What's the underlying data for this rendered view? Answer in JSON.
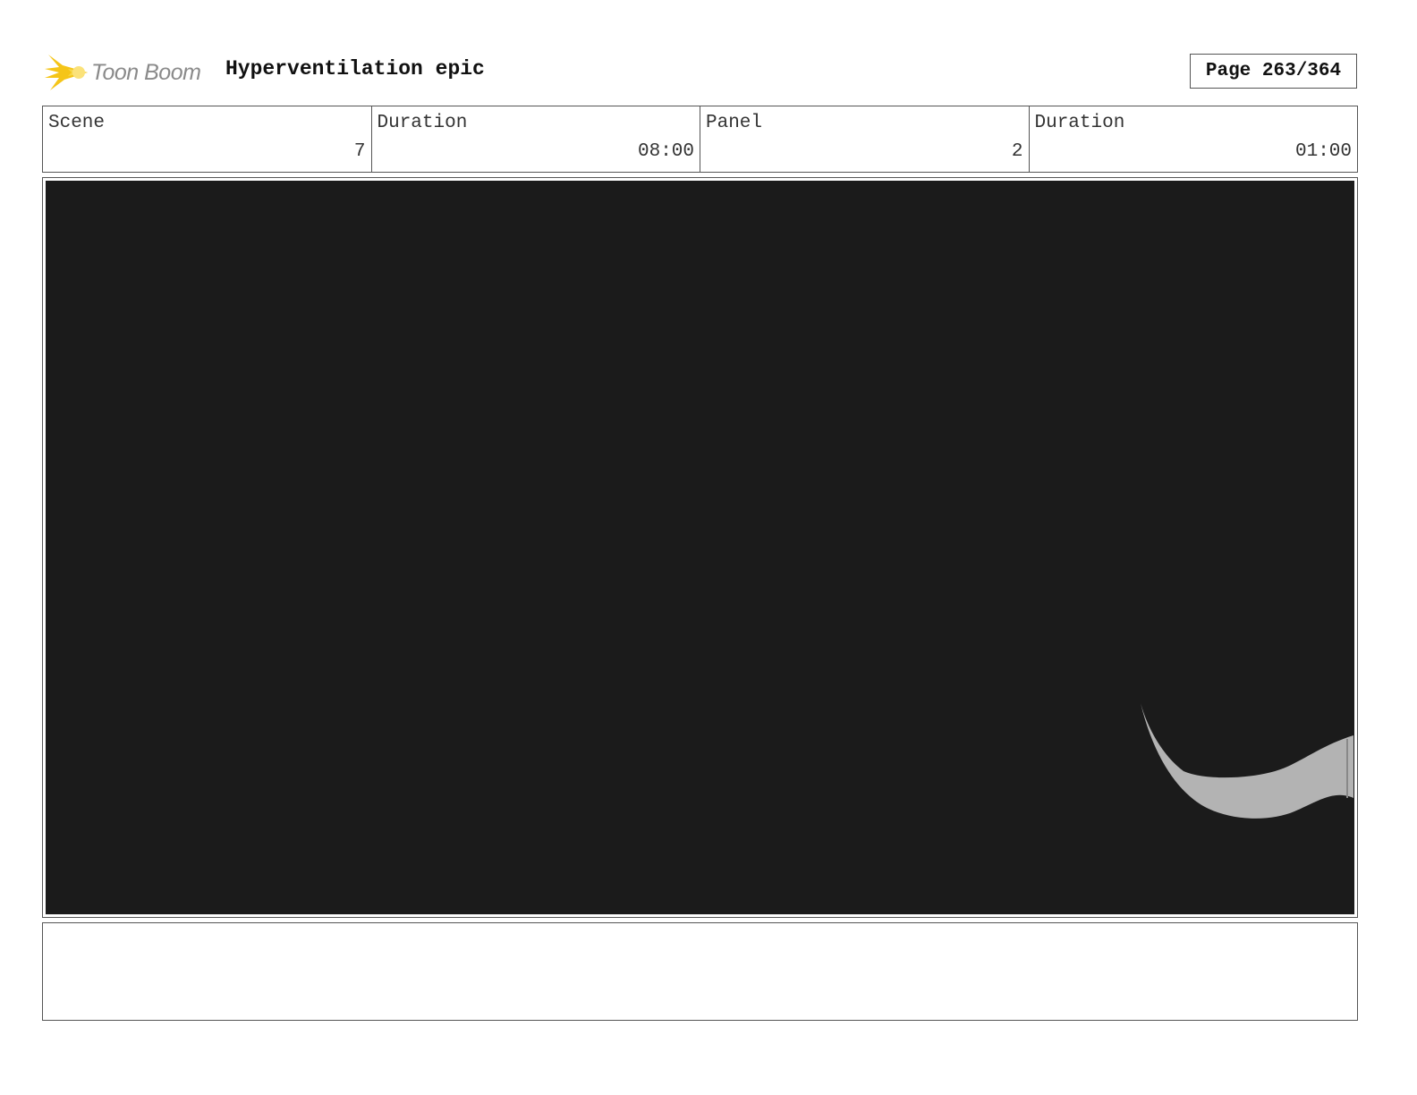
{
  "header": {
    "logo_text": "Toon Boom",
    "project_title": "Hyperventilation epic",
    "page_label": "Page 263/364"
  },
  "info": {
    "scene_label": "Scene",
    "scene_value": "7",
    "scene_duration_label": "Duration",
    "scene_duration_value": "08:00",
    "panel_label": "Panel",
    "panel_value": "2",
    "panel_duration_label": "Duration",
    "panel_duration_value": "01:00"
  },
  "panel": {
    "background_color": "#1b1b1b",
    "shape_color": "#b3b3b3"
  },
  "notes": {
    "text": ""
  },
  "colors": {
    "logo_flame": "#f5c518",
    "logo_text": "#8a8a8a",
    "border": "#555555"
  }
}
